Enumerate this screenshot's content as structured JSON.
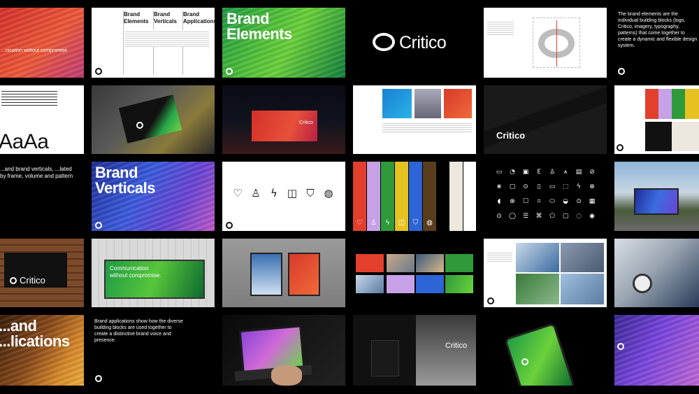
{
  "brand": {
    "name": "Critico"
  },
  "row1": {
    "hero_tagline": "...nication without compromise",
    "toc_heading_1": "Brand Elements",
    "toc_heading_2": "Brand Verticals",
    "toc_heading_3": "Brand Applications",
    "elements_title": "Brand Elements",
    "logo_wordmark": "Critico",
    "intro_text": "The brand elements are the individual building blocks (logo, Critico, imagery, typography, patterns) that come together to create a dynamic and flexible design system."
  },
  "row2": {
    "type_sample": "AaAa",
    "billboard_word": "Critico",
    "banner_word": "Critico"
  },
  "row3": {
    "verticals_intro": "...and brand verticals, ...lated by frame, volume and pattern",
    "verticals_title": "Brand Verticals",
    "icon_glyphs": [
      "♡",
      "♙",
      "ϟ",
      "◫",
      "⛉",
      "◍"
    ],
    "bar_glyphs": [
      "♡",
      "♙",
      "ϟ",
      "◫",
      "⛉",
      "◍"
    ],
    "grid_glyphs": [
      "▭",
      "◔",
      "▣",
      "ℇ",
      "♙",
      "⩚",
      "▤",
      "⊘",
      "⋇",
      "▢",
      "⊙",
      "▯",
      "▭",
      "⬚",
      "ϟ",
      "⊕",
      "◖",
      "⊗",
      "☐",
      "⌗",
      "⬭",
      "◒",
      "⊙",
      "▦",
      "⊙",
      "◯",
      "☰",
      "⌘",
      "⬠",
      "▢",
      "◌",
      "◉"
    ]
  },
  "row4": {
    "sign_word": "Critico",
    "board_line_1": "Communication",
    "board_line_2": "without compromise."
  },
  "row5": {
    "apps_title": "...and ...lications",
    "apps_text": "Brand applications show how the diverse building blocks are used together to create a distinctive brand voice and presence.",
    "facade_word": "Critico"
  },
  "colors": {
    "red": "#e2402c",
    "lilac": "#c7a1e8",
    "green": "#2f9a3a",
    "yellow": "#e5c21f",
    "blue": "#2d64d6",
    "brown": "#5a3d1c",
    "sand": "#ece7df"
  },
  "icons": {
    "logo_mark": "critico-ring-logo",
    "heart": "heart-icon",
    "person": "person-icon",
    "bolt": "bolt-icon",
    "book": "book-icon",
    "shield": "shield-icon",
    "globe": "globe-icon"
  }
}
